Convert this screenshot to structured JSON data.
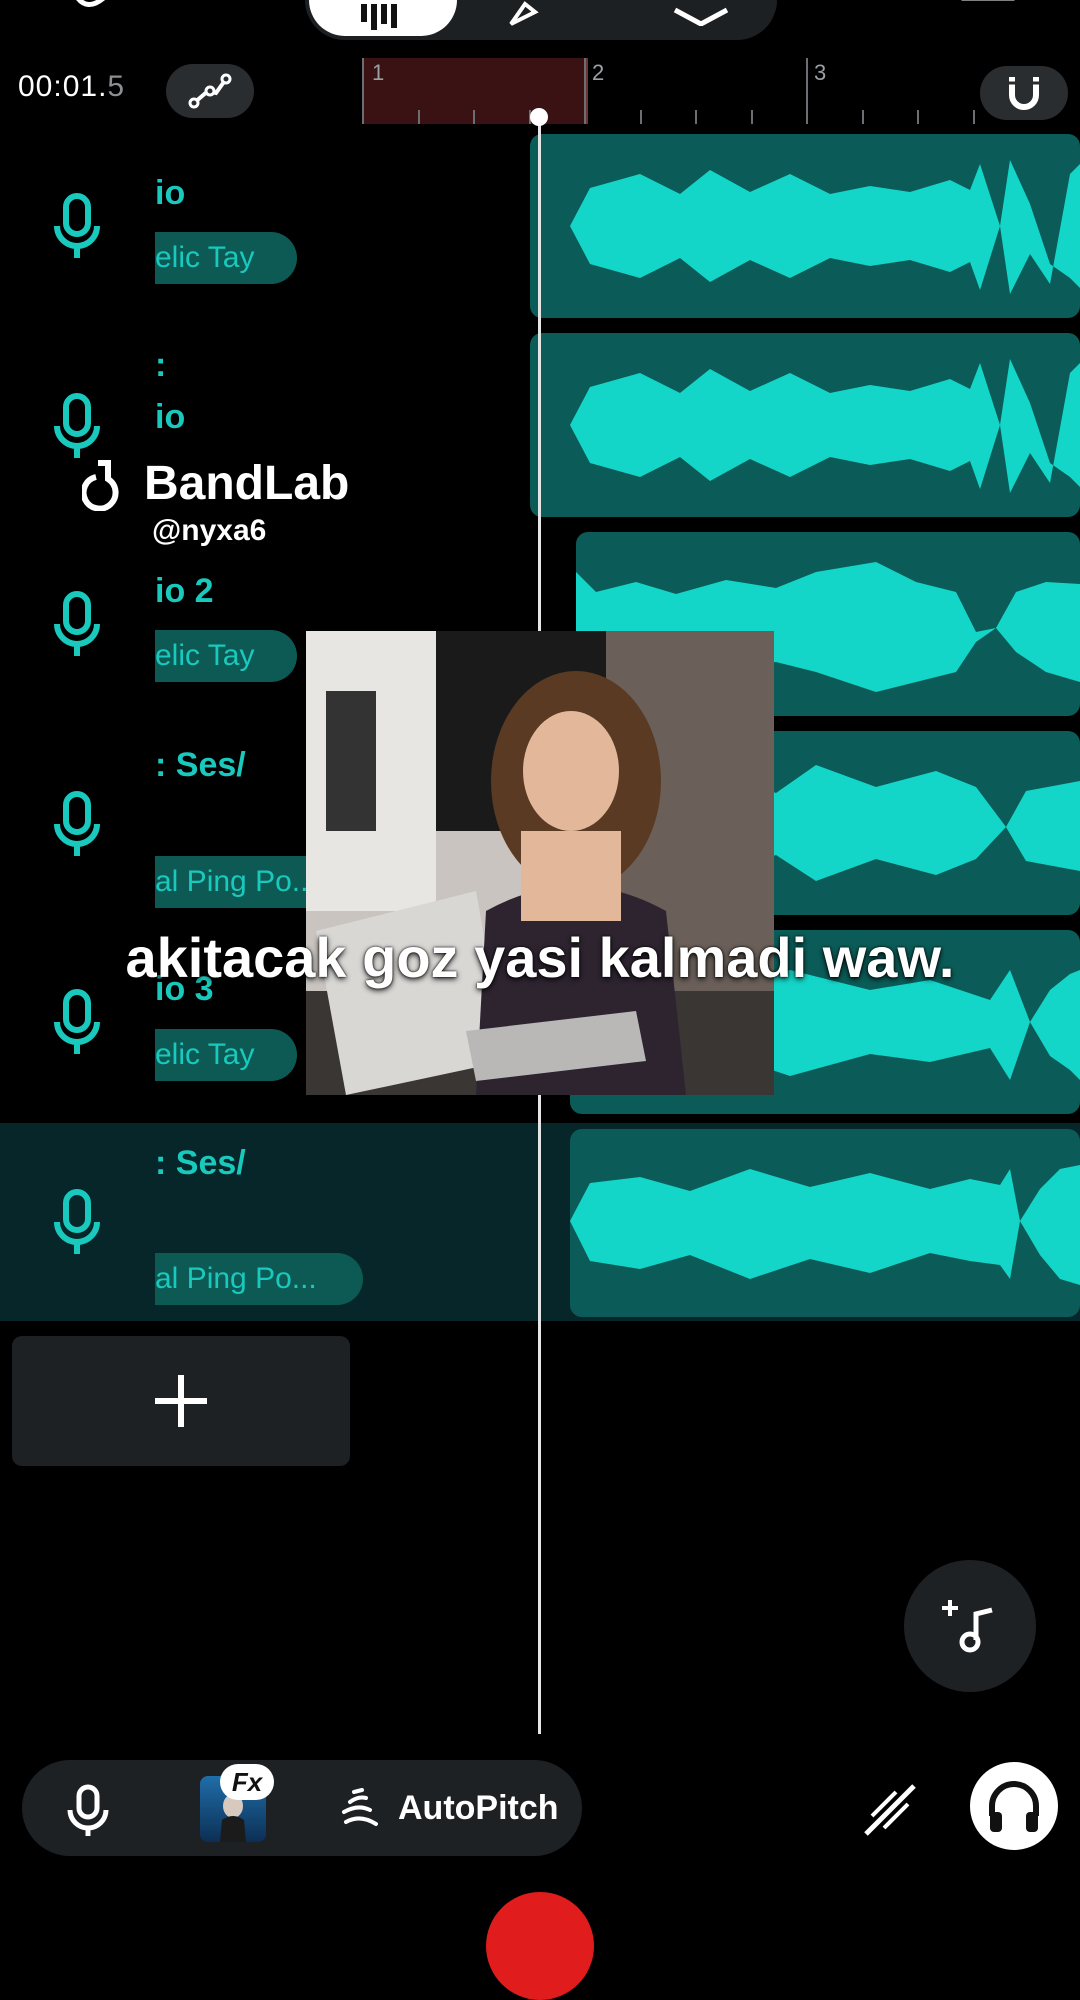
{
  "header": {
    "time_main": "00:01.",
    "time_fraction": "5",
    "bars": [
      "1",
      "2",
      "3"
    ]
  },
  "tracks": [
    {
      "name": "io",
      "pill": "elic Tay",
      "selected": false
    },
    {
      "name": "io",
      "pill": "",
      "selected": false
    },
    {
      "name": "io 2",
      "pill": "elic Tay",
      "selected": false
    },
    {
      "name": ": Ses/",
      "pill": "al Ping Po...",
      "selected": false
    },
    {
      "name": "io 3",
      "pill": "elic Tay",
      "selected": false
    },
    {
      "name": ": Ses/",
      "pill": "al Ping Po...",
      "selected": true
    }
  ],
  "track_extra_text": ":",
  "watermark": {
    "brand": "BandLab",
    "user": "@nyxa6"
  },
  "caption": "akitacak goz yasi kalmadi waw.",
  "bottom": {
    "fx_label": "Fx",
    "autopitch_label": "AutoPitch"
  },
  "colors": {
    "accent": "#19c9bd",
    "clip": "#0b5c58",
    "wave": "#14d6c8",
    "record": "#e01c1c",
    "loop": "#3a1214"
  },
  "icons": [
    "undo-icon",
    "waveform-icon",
    "pen-icon",
    "layers-icon",
    "loop-icon",
    "automation-icon",
    "magnet-icon",
    "mic-icon",
    "add-icon",
    "add-instrument-icon",
    "autopitch-icon",
    "tuner-icon",
    "headphones-icon",
    "record-icon"
  ]
}
